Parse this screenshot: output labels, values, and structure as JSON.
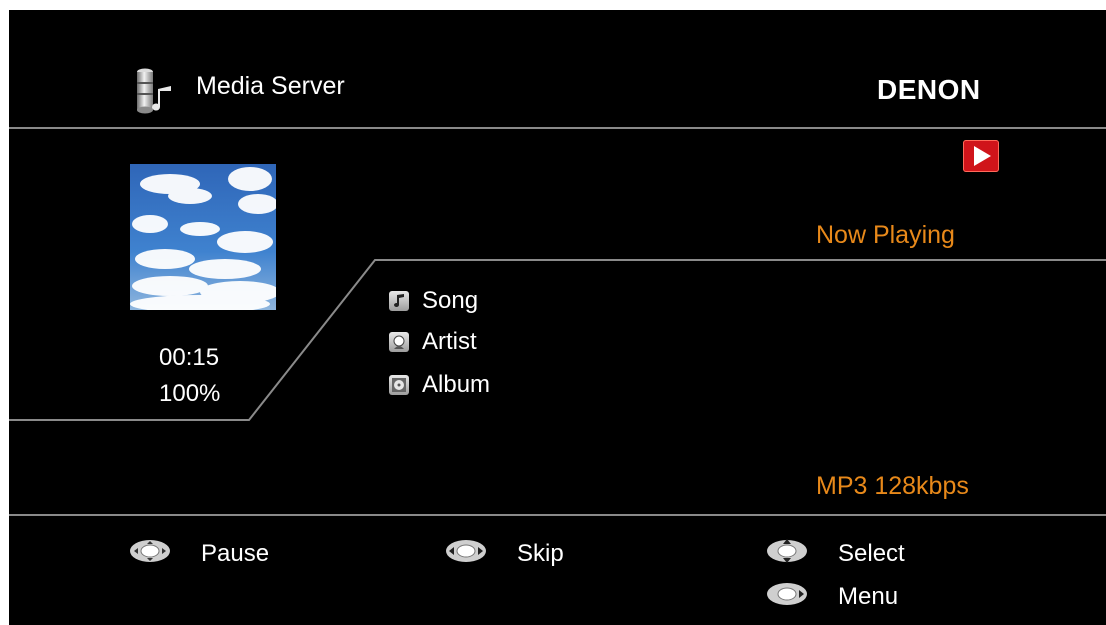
{
  "header": {
    "source_icon": "media-server-icon",
    "title": "Media Server",
    "brand": "DENON"
  },
  "status": {
    "play_state_icon": "play-icon",
    "now_playing_label": "Now Playing",
    "elapsed_time": "00:15",
    "progress_text": "100%",
    "format": "MP3 128kbps"
  },
  "album_art": {
    "icon": "album-art-sky-image"
  },
  "track_info": [
    {
      "icon": "music-note-icon",
      "label": "Song"
    },
    {
      "icon": "artist-icon",
      "label": "Artist"
    },
    {
      "icon": "album-disc-icon",
      "label": "Album"
    }
  ],
  "controls": [
    {
      "icon": "dpad-select-icon",
      "label": "Pause"
    },
    {
      "icon": "dpad-leftright-icon",
      "label": "Skip"
    },
    {
      "icon": "dpad-updown-icon",
      "label": "Select"
    },
    {
      "icon": "dpad-left-icon",
      "label": "Menu"
    }
  ],
  "colors": {
    "background": "#000000",
    "accent_text": "#e8891a",
    "divider": "#8a8a8a",
    "play_badge": "#d0141a"
  }
}
